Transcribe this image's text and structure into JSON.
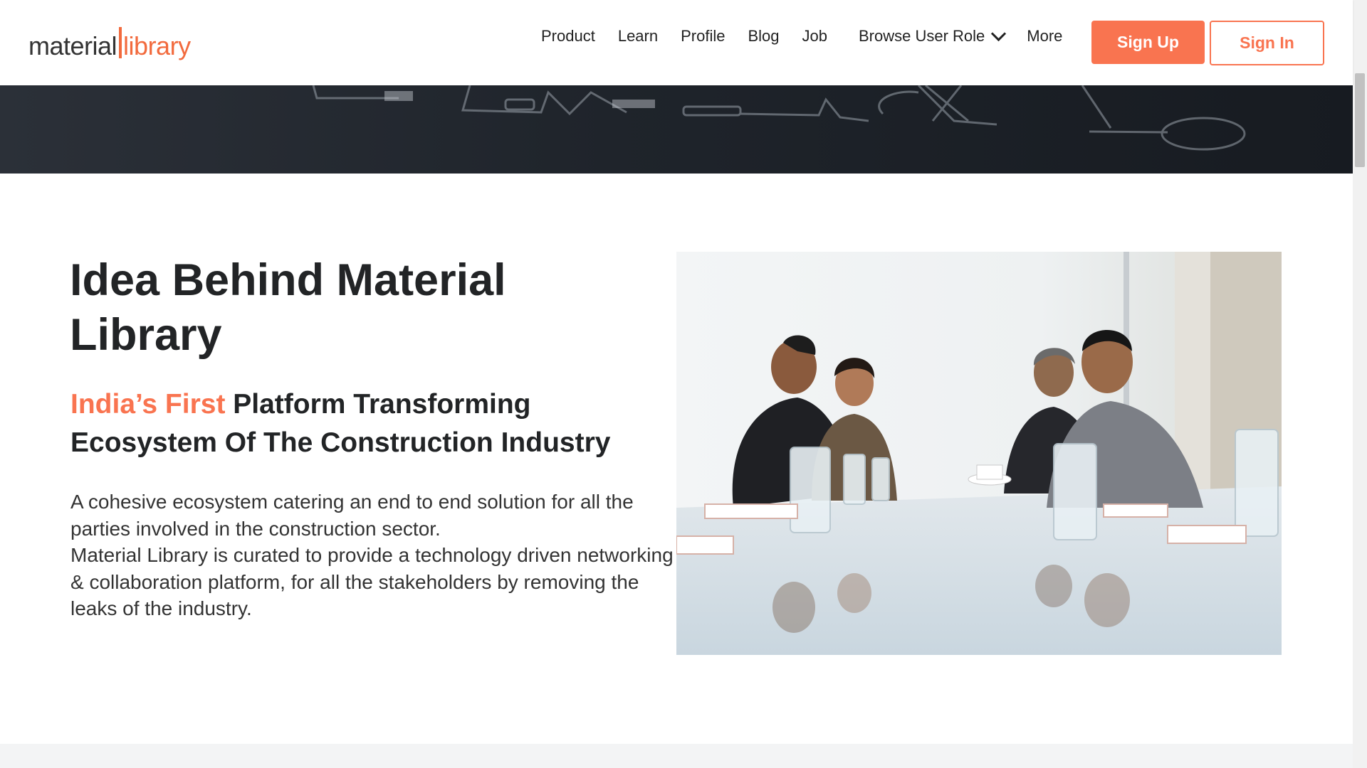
{
  "header": {
    "logo": {
      "part1": "material",
      "part2": "library"
    },
    "nav": {
      "product": "Product",
      "learn": "Learn",
      "profile": "Profile",
      "blog": "Blog",
      "job": "Job",
      "browse_user_role": "Browse User Role",
      "more": "More"
    },
    "signup_label": "Sign Up",
    "signin_label": "Sign In"
  },
  "about": {
    "title": "Idea Behind Material Library",
    "subtitle_accent": "India’s First",
    "subtitle_rest": " Platform Transforming Ecosystem Of The Construction Industry",
    "paragraph1": "A cohesive ecosystem catering an end to end solution for all the parties involved in the construction sector.",
    "paragraph2": "Material Library is curated to provide a technology driven networking & collaboration platform, for all the stakeholders by removing the leaks of the industry."
  },
  "icons": {
    "browse_user_role_dropdown": "chevron-down-icon"
  },
  "colors": {
    "accent": "#f97450",
    "text_dark": "#222426",
    "banner": "#1f242b"
  }
}
